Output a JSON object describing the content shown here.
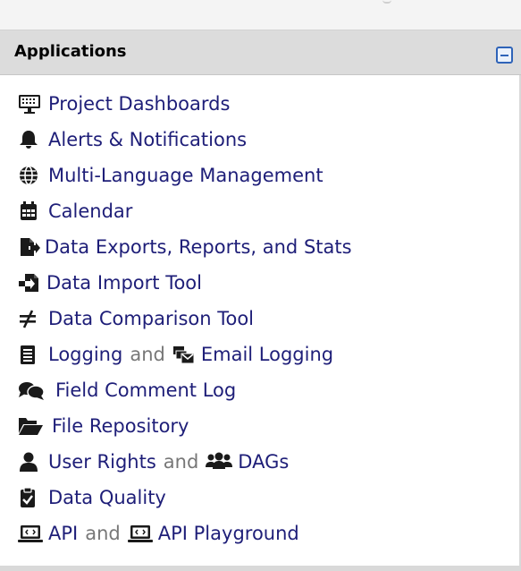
{
  "panel": {
    "title": "Applications"
  },
  "items": {
    "project_dashboards": "Project Dashboards",
    "alerts": "Alerts & Notifications",
    "multi_language": "Multi-Language Management",
    "calendar": "Calendar",
    "data_exports": "Data Exports, Reports, and Stats",
    "data_import": "Data Import Tool",
    "data_comparison": "Data Comparison Tool",
    "logging": "Logging",
    "email_logging": "Email Logging",
    "field_comment_log": "Field Comment Log",
    "file_repository": "File Repository",
    "user_rights": "User Rights",
    "dags": "DAGs",
    "data_quality": "Data Quality",
    "api": "API",
    "api_playground": "API Playground"
  },
  "connector": "and",
  "icons": {
    "project_dashboards": "dashboard-monitor-icon",
    "alerts": "bell-icon",
    "multi_language": "globe-icon",
    "calendar": "calendar-icon",
    "data_exports": "file-export-icon",
    "data_import": "file-import-icon",
    "data_comparison": "not-equal-icon",
    "logging": "list-document-icon",
    "email_logging": "mail-bulk-icon",
    "field_comment_log": "comments-icon",
    "file_repository": "folder-open-icon",
    "user_rights": "user-icon",
    "dags": "users-group-icon",
    "data_quality": "clipboard-check-icon",
    "api": "laptop-code-icon",
    "api_playground": "laptop-code-icon"
  },
  "colors": {
    "link": "#1e1e78",
    "connector": "#777777",
    "header_bg": "#dcdcdc",
    "collapse_accent": "#2e63b8"
  }
}
